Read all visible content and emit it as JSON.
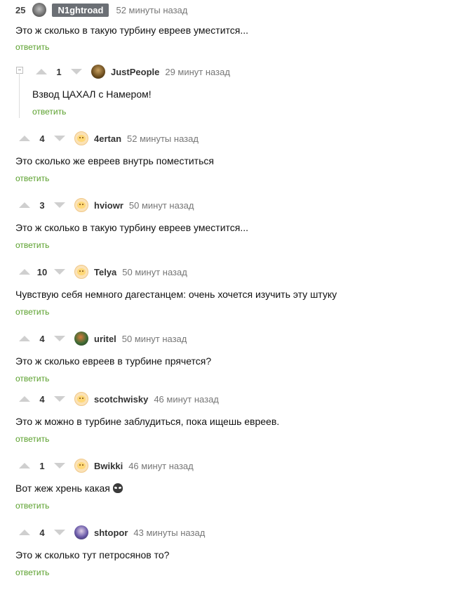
{
  "top_comment": {
    "rank": "25",
    "user": "N1ghtroad",
    "time": "52 минуты назад",
    "text": "Это ж сколько в такую турбину евреев уместится...",
    "reply": "ответить"
  },
  "nested_reply": {
    "score": "1",
    "user": "JustPeople",
    "time": "29 минут назад",
    "text": "Взвод ЦАХАЛ с Намером!",
    "reply": "ответить"
  },
  "comments": [
    {
      "score": "4",
      "user": "4ertan",
      "time": "52 минуты назад",
      "text": "Это сколько же евреев внутрь поместиться",
      "reply": "ответить",
      "avatar": "emoji-avatar"
    },
    {
      "score": "3",
      "user": "hviowr",
      "time": "50 минут назад",
      "text": "Это ж сколько в такую турбину евреев уместится...",
      "reply": "ответить",
      "avatar": "emoji-avatar"
    },
    {
      "score": "10",
      "user": "Telya",
      "time": "50 минут назад",
      "text": "Чувствую себя немного дагестанцем: очень хочется изучить эту штуку",
      "reply": "ответить",
      "avatar": "emoji-avatar"
    },
    {
      "score": "4",
      "user": "uritel",
      "time": "50 минут назад",
      "text": "Это ж сколько евреев в турбине прячется?",
      "reply": "ответить",
      "avatar": "photo-avatar"
    },
    {
      "score": "4",
      "user": "scotchwisky",
      "time": "46 минут назад",
      "text": "Это ж можно в турбине заблудиться, пока ищешь евреев.",
      "reply": "ответить",
      "avatar": "emoji-avatar"
    },
    {
      "score": "1",
      "user": "Bwikki",
      "time": "46 минут назад",
      "text": "Вот жеж хрень какая",
      "reply": "ответить",
      "avatar": "emoji-avatar",
      "emoji": "alien-icon"
    },
    {
      "score": "4",
      "user": "shtopor",
      "time": "43 минуты назад",
      "text": "Это ж сколько тут петросянов то?",
      "reply": "ответить",
      "avatar": "photo-avatar"
    }
  ]
}
